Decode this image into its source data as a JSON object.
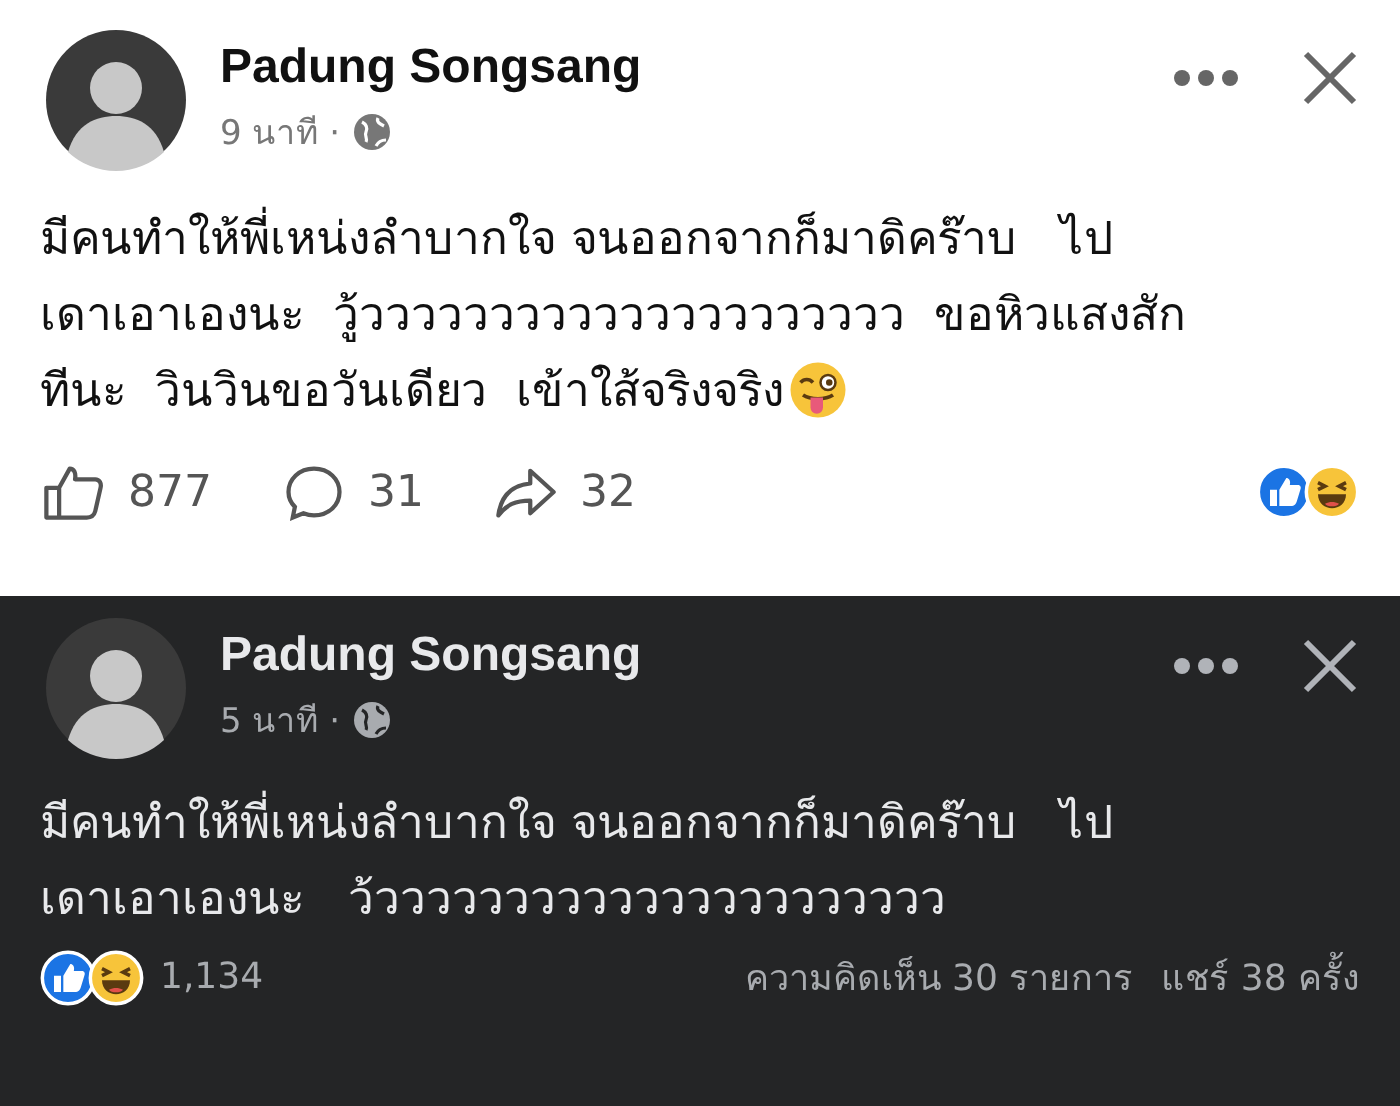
{
  "posts": [
    {
      "dark": false,
      "author": "Padung Songsang",
      "time": "9 นาที ·",
      "body_lines": [
        "มีคนทำให้พี่เหน่งลำบากใจ จนออกจากก็มาดิคร๊าบ   ไป",
        "เดาเอาเองนะ  วู้ววววววววววววววววววววว  ขอหิวแสงสัก",
        "ทีนะ  วินวินขอวันเดียว  เข้าใส้จริงจริง"
      ],
      "trailing_emoji": true,
      "footer": {
        "kind": "actions",
        "likes": "877",
        "comments": "31",
        "shares": "32"
      }
    },
    {
      "dark": true,
      "author": "Padung Songsang",
      "time": "5 นาที ·",
      "body_lines": [
        "มีคนทำให้พี่เหน่งลำบากใจ จนออกจากก็มาดิคร๊าบ   ไป",
        "เดาเอาเองนะ   ว้วววววววววววววววววววววว"
      ],
      "trailing_emoji": false,
      "footer": {
        "kind": "summary",
        "reactions": "1,134",
        "comments": "ความคิดเห็น 30 รายการ",
        "shares": "แชร์ 38 ครั้ง"
      }
    }
  ]
}
